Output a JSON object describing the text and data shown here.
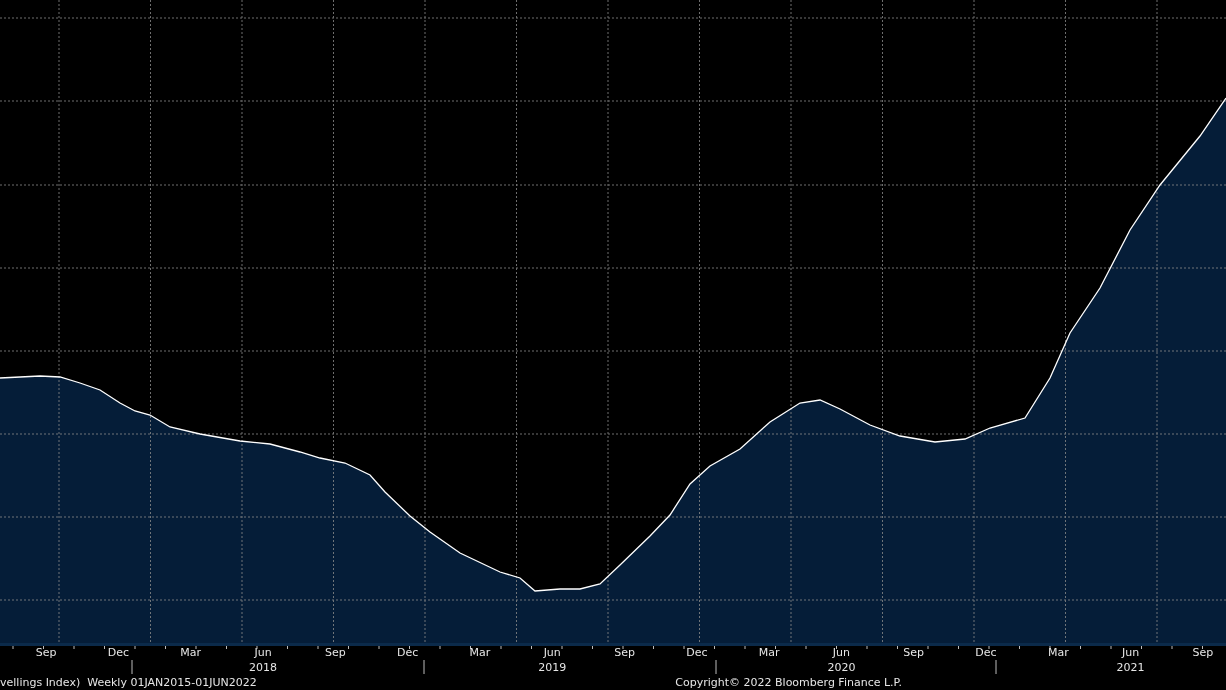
{
  "x_axis": {
    "months": [
      "Sep",
      "Dec",
      "Mar",
      "Jun",
      "Sep",
      "Dec",
      "Mar",
      "Jun",
      "Sep",
      "Dec",
      "Mar",
      "Jun",
      "Sep",
      "Dec",
      "Mar",
      "Jun",
      "Sep"
    ],
    "years": [
      "2018",
      "2019",
      "2020",
      "2021"
    ]
  },
  "footer": {
    "series_description": "vellings Index)  Weekly 01JAN2015-01JUN2022",
    "copyright": "Copyright© 2022 Bloomberg Finance L.P."
  }
}
